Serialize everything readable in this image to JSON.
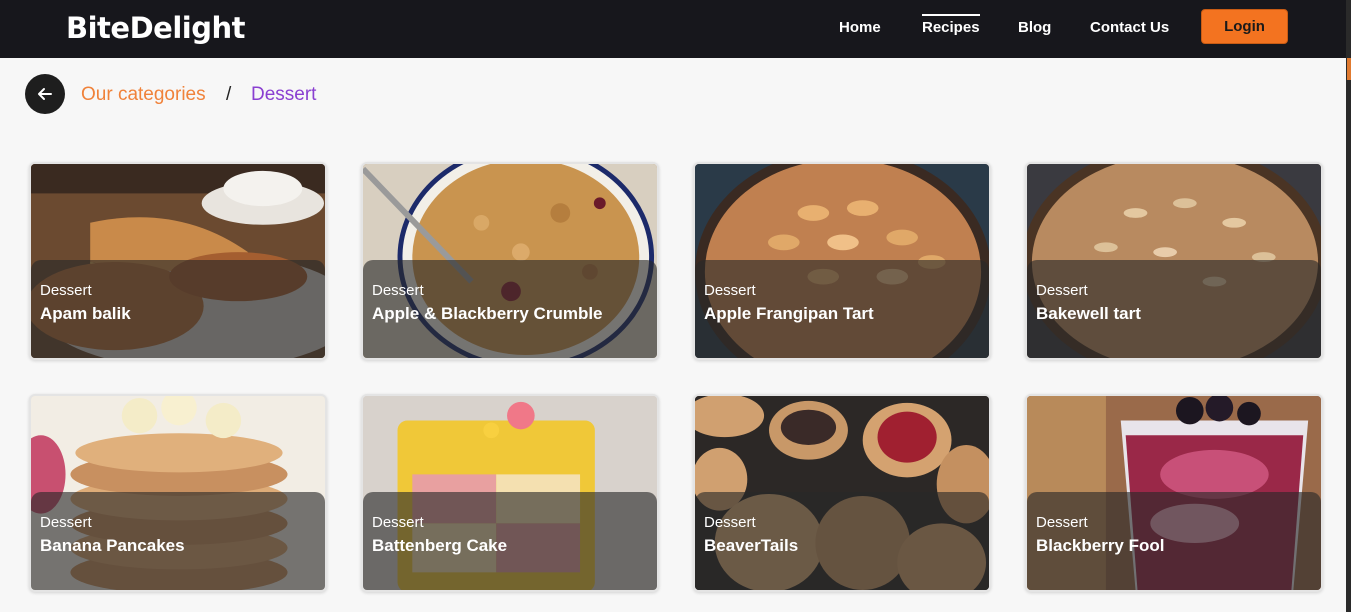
{
  "header": {
    "brand": "BiteDelight",
    "nav": [
      {
        "label": "Home"
      },
      {
        "label": "Recipes"
      },
      {
        "label": "Blog"
      },
      {
        "label": "Contact Us"
      }
    ],
    "login_label": "Login"
  },
  "breadcrumb": {
    "parent": "Our categories",
    "separator": "/",
    "current": "Dessert"
  },
  "icons": {
    "back": "arrow-left-icon"
  },
  "colors": {
    "accent": "#f37320",
    "crumb_parent": "#f0823a",
    "crumb_current": "#8a3fd1",
    "navbar": "#17171c"
  },
  "recipes": [
    {
      "category": "Dessert",
      "name": "Apam balik"
    },
    {
      "category": "Dessert",
      "name": "Apple & Blackberry Crumble"
    },
    {
      "category": "Dessert",
      "name": "Apple Frangipan Tart"
    },
    {
      "category": "Dessert",
      "name": "Bakewell tart"
    },
    {
      "category": "Dessert",
      "name": "Banana Pancakes"
    },
    {
      "category": "Dessert",
      "name": "Battenberg Cake"
    },
    {
      "category": "Dessert",
      "name": "BeaverTails"
    },
    {
      "category": "Dessert",
      "name": "Blackberry Fool"
    }
  ]
}
